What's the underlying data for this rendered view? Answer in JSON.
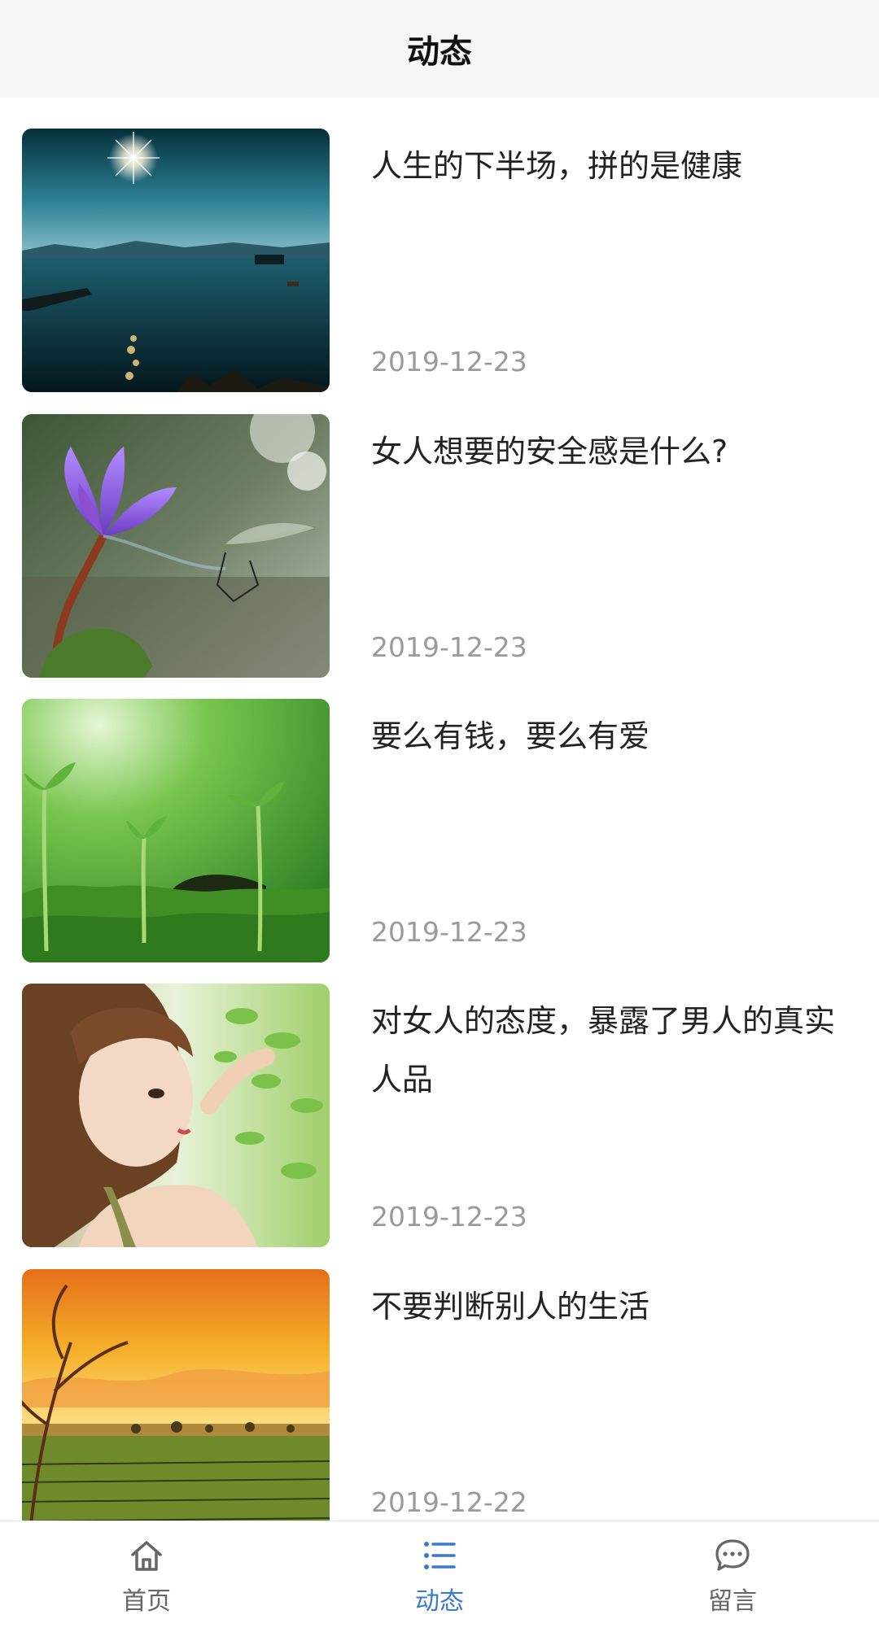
{
  "header": {
    "title": "动态"
  },
  "feed": [
    {
      "title": "人生的下半场，拼的是健康",
      "date": "2019-12-23"
    },
    {
      "title": "女人想要的安全感是什么?",
      "date": "2019-12-23"
    },
    {
      "title": "要么有钱，要么有爱",
      "date": "2019-12-23"
    },
    {
      "title": "对女人的态度，暴露了男人的真实人品",
      "date": "2019-12-23"
    },
    {
      "title": "不要判断别人的生活",
      "date": "2019-12-22"
    }
  ],
  "tabbar": {
    "active_color": "#3a7ac9",
    "inactive_color": "#666666",
    "tabs": [
      {
        "label": "首页",
        "icon": "home-icon"
      },
      {
        "label": "动态",
        "icon": "list-icon"
      },
      {
        "label": "留言",
        "icon": "chat-icon"
      }
    ]
  }
}
